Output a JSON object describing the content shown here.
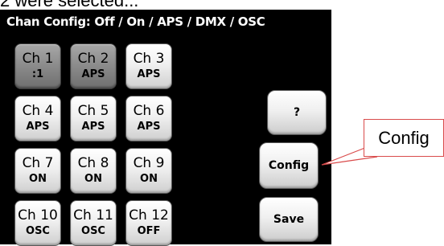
{
  "caption": "2 were selected...",
  "panel": {
    "title": "Chan Config: Off / On / APS / DMX / OSC"
  },
  "channels": [
    {
      "name": "Ch 1",
      "mode": ":1",
      "selected": true
    },
    {
      "name": "Ch 2",
      "mode": "APS",
      "selected": true
    },
    {
      "name": "Ch 3",
      "mode": "APS",
      "selected": false
    },
    {
      "name": "Ch 4",
      "mode": "APS",
      "selected": false
    },
    {
      "name": "Ch 5",
      "mode": "APS",
      "selected": false
    },
    {
      "name": "Ch 6",
      "mode": "APS",
      "selected": false
    },
    {
      "name": "Ch 7",
      "mode": "ON",
      "selected": false
    },
    {
      "name": "Ch 8",
      "mode": "ON",
      "selected": false
    },
    {
      "name": "Ch 9",
      "mode": "ON",
      "selected": false
    },
    {
      "name": "Ch 10",
      "mode": "OSC",
      "selected": false
    },
    {
      "name": "Ch 11",
      "mode": "OSC",
      "selected": false
    },
    {
      "name": "Ch 12",
      "mode": "OFF",
      "selected": false
    }
  ],
  "side_buttons": {
    "help": "?",
    "config": "Config",
    "save": "Save"
  },
  "callout": {
    "label": "Config",
    "color": "#d94b4b"
  }
}
